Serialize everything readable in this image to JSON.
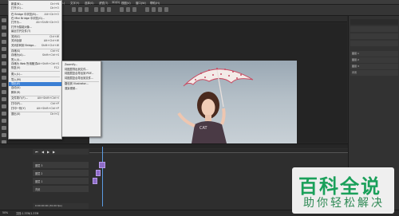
{
  "menubar": {
    "items": [
      "文件(F)",
      "编辑(E)",
      "图像(I)",
      "图层(L)",
      "文字(Y)",
      "选择(S)",
      "滤镜(T)",
      "3D(D)",
      "视图(V)",
      "窗口(W)",
      "帮助(H)"
    ]
  },
  "tabs": [
    "未标题-1 @ 50%(RGB/8)"
  ],
  "file_menu": {
    "items": [
      {
        "label": "新建(N)...",
        "sc": "Ctrl+N"
      },
      {
        "label": "打开(O)...",
        "sc": "Ctrl+O"
      },
      {
        "label": "在 Bridge 中浏览(B)...",
        "sc": "Alt+Ctrl+O"
      },
      {
        "label": "在 Mini Bridge 中浏览(G)...",
        "sc": ""
      },
      {
        "label": "打开为...",
        "sc": "Alt+Shift+Ctrl+O"
      },
      {
        "label": "打开为智能对象...",
        "sc": ""
      },
      {
        "label": "最近打开文件(T)",
        "sc": ""
      },
      {
        "label": "关闭(C)",
        "sc": "Ctrl+W"
      },
      {
        "label": "关闭全部",
        "sc": "Alt+Ctrl+W"
      },
      {
        "label": "关闭并转到 Bridge...",
        "sc": "Shift+Ctrl+W"
      },
      {
        "label": "存储(S)",
        "sc": "Ctrl+S"
      },
      {
        "label": "存储为(A)...",
        "sc": "Shift+Ctrl+S"
      },
      {
        "label": "签入(I)...",
        "sc": ""
      },
      {
        "label": "存储为 Web 所用格式...",
        "sc": "Alt+Shift+Ctrl+S"
      },
      {
        "label": "恢复(V)",
        "sc": "F12"
      },
      {
        "label": "置入(L)...",
        "sc": ""
      },
      {
        "label": "导入(M)",
        "sc": ""
      },
      {
        "label": "导出(E)",
        "sc": ""
      },
      {
        "label": "自动(U)",
        "sc": ""
      },
      {
        "label": "脚本(R)",
        "sc": ""
      },
      {
        "label": "文件简介(F)...",
        "sc": "Alt+Shift+Ctrl+I"
      },
      {
        "label": "打印(P)...",
        "sc": "Ctrl+P"
      },
      {
        "label": "打印一份(Y)",
        "sc": "Alt+Shift+Ctrl+P"
      },
      {
        "label": "退出(X)",
        "sc": "Ctrl+Q"
      }
    ]
  },
  "export_menu": {
    "items": [
      {
        "label": "Zoomify...",
        "sc": "",
        "dis": false
      },
      {
        "label": "将图层导出到文件...",
        "sc": "",
        "dis": false
      },
      {
        "label": "将图层复合导出到 PDF...",
        "sc": "",
        "dis": false
      },
      {
        "label": "将图层复合导出到文件...",
        "sc": "",
        "dis": false
      },
      {
        "label": "路径到 Illustrator...",
        "sc": "",
        "dis": false
      },
      {
        "label": "渲染视频...",
        "sc": "",
        "dis": false
      }
    ]
  },
  "layers": [
    "图层 1",
    "图层 2",
    "图层 3",
    "背景"
  ],
  "timeline": {
    "rows": [
      "图层 3",
      "图层 2",
      "图层 1",
      "背景"
    ],
    "time": "0:00:00:00",
    "fps": "(30.00 fps)"
  },
  "status": {
    "zoom": "50%",
    "doc": "文档:1.37M/1.37M"
  },
  "watermark": {
    "line1": "百科全说",
    "line2": "助你轻松解决"
  },
  "colors": {
    "highlight": "#3b7fd4",
    "frame": "#8e6cc7",
    "watermark_green": "#1aa05a"
  }
}
